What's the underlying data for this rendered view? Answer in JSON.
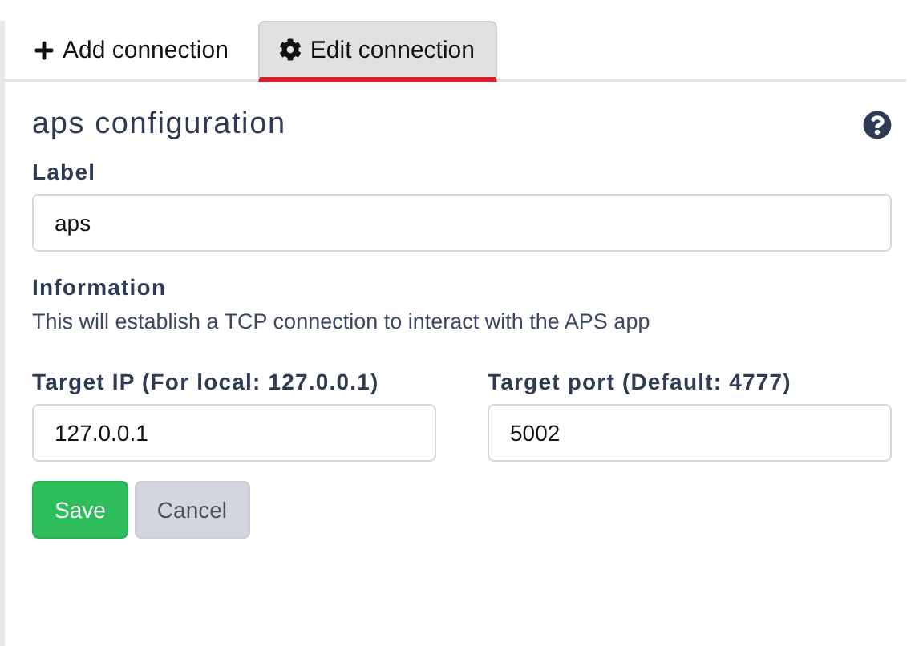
{
  "tabs": [
    {
      "label": "Add connection",
      "kind": "add",
      "selected": false
    },
    {
      "label": "Edit connection",
      "kind": "edit",
      "selected": true
    }
  ],
  "title": "aps configuration",
  "label_field": {
    "label": "Label",
    "value": "aps"
  },
  "information": {
    "heading": "Information",
    "text": "This will establish a TCP connection to interact with the APS app"
  },
  "target_fields": [
    {
      "label": "Target IP (For local: 127.0.0.1)",
      "value": "127.0.0.1"
    },
    {
      "label": "Target port (Default: 4777)",
      "value": "5002"
    }
  ],
  "buttons": [
    {
      "label": "Save",
      "kind": "primary"
    },
    {
      "label": "Cancel",
      "kind": "secondary"
    }
  ]
}
